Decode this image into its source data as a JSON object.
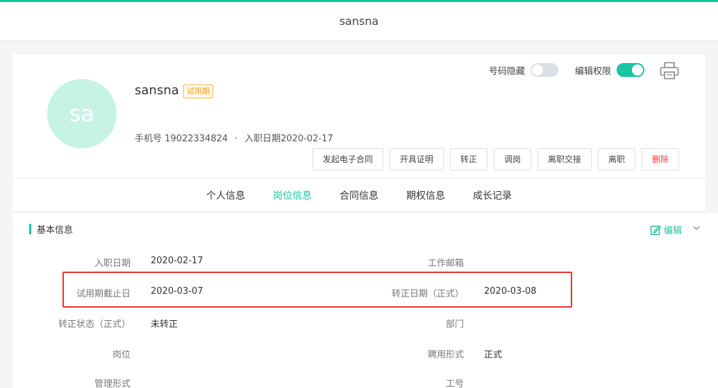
{
  "header": {
    "title": "sansna"
  },
  "profile": {
    "avatar_text": "sa",
    "name": "sansna",
    "status_badge": "试用期",
    "phone_label": "手机号",
    "phone": "19022334824",
    "join_label": "入职日期",
    "join_date": "2020-02-17",
    "hide_number_label": "号码隐藏",
    "edit_permission_label": "编辑权限",
    "hide_number_on": false,
    "edit_permission_on": true
  },
  "actions": {
    "e_contract": "发起电子合同",
    "certificate": "开具证明",
    "regularize": "转正",
    "transfer": "调岗",
    "handover": "离职交接",
    "resign": "离职",
    "delete": "删除"
  },
  "tabs": [
    {
      "label": "个人信息",
      "active": false
    },
    {
      "label": "岗位信息",
      "active": true
    },
    {
      "label": "合同信息",
      "active": false
    },
    {
      "label": "期权信息",
      "active": false
    },
    {
      "label": "成长记录",
      "active": false
    }
  ],
  "section": {
    "title": "基本信息",
    "edit_label": "编辑"
  },
  "fields": [
    {
      "label": "入职日期",
      "value": "2020-02-17",
      "label2": "工作邮箱",
      "value2": ""
    },
    {
      "label": "试用期截止日",
      "value": "2020-03-07",
      "label2": "转正日期（正式）",
      "value2": "2020-03-08"
    },
    {
      "label": "转正状态（正式）",
      "value": "未转正",
      "label2": "部门",
      "value2": ""
    },
    {
      "label": "岗位",
      "value": "",
      "label2": "聘用形式",
      "value2": "正式"
    },
    {
      "label": "管理形式",
      "value": "",
      "label2": "工号",
      "value2": ""
    }
  ],
  "colors": {
    "accent": "#19c4a0",
    "danger": "#f03a3a",
    "highlight": "#e8322c",
    "badge": "#f5a000"
  }
}
